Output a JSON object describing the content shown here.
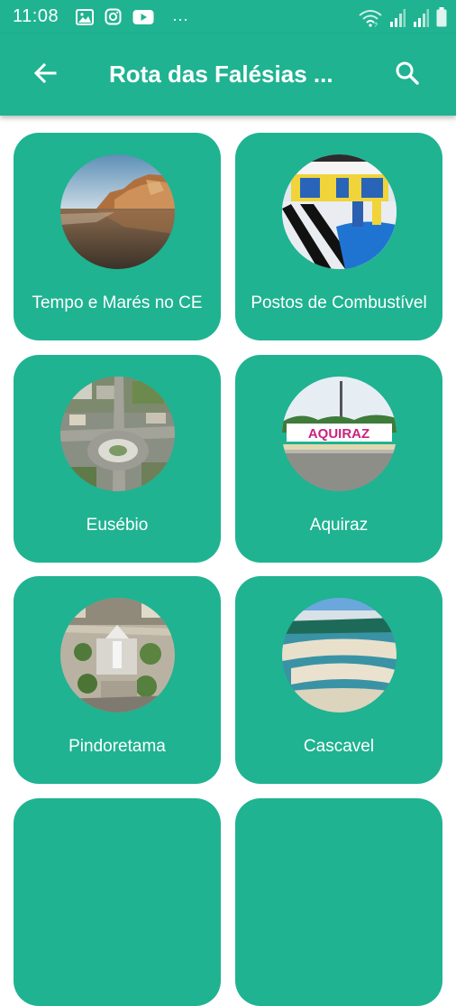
{
  "status_bar": {
    "time": "11:08",
    "icons": [
      "image-icon",
      "instagram-icon",
      "youtube-icon",
      "more-dots-icon",
      "wifi-icon",
      "signal-icon",
      "signal-icon",
      "battery-icon"
    ],
    "more_dots": "···"
  },
  "app_bar": {
    "title": "Rota das Falésias ...",
    "back_icon": "arrow-left-icon",
    "search_icon": "search-icon"
  },
  "colors": {
    "primary": "#1fb391",
    "on_primary": "#ffffff",
    "background": "#ffffff"
  },
  "cards": [
    {
      "label": "Tempo e Marés no CE",
      "image": "cliffs-beach-photo"
    },
    {
      "label": "Postos de Combustível",
      "image": "gas-station-photo"
    },
    {
      "label": "Eusébio",
      "image": "roundabout-aerial-photo"
    },
    {
      "label": "Aquiraz",
      "image": "aquiraz-sign-photo"
    },
    {
      "label": "Pindoretama",
      "image": "church-aerial-photo"
    },
    {
      "label": "Cascavel",
      "image": "lagoon-sandbar-photo"
    },
    {
      "label": "",
      "image": ""
    },
    {
      "label": "",
      "image": ""
    }
  ]
}
